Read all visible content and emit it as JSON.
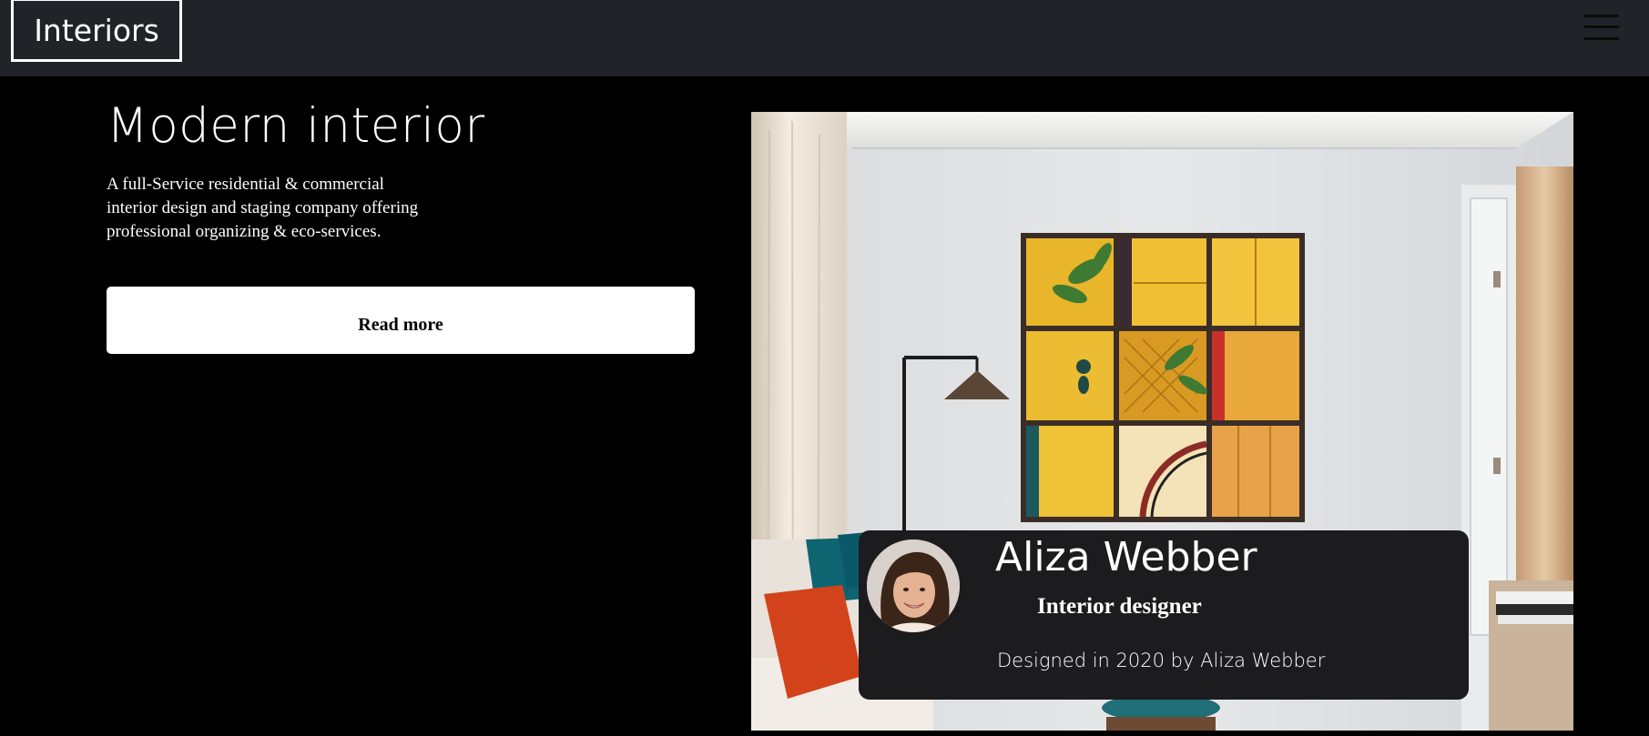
{
  "navbar": {
    "brand": "Interiors",
    "menu_icon": "hamburger-menu-icon"
  },
  "hero": {
    "title": "Modern interior",
    "description": "A full-Service residential & commercial interior design and staging company offering professional organizing & eco-services.",
    "button_label": "Read more"
  },
  "media": {
    "room_image": "modern-living-room-photo"
  },
  "profile_card": {
    "name": "Aliza Webber",
    "role": "Interior designer",
    "credit": "Designed in 2020 by Aliza Webber",
    "avatar": "avatar-photo"
  },
  "colors": {
    "page_background": "#000000",
    "navbar_background": "#212328",
    "card_background": "#1c1c1e",
    "button_background": "#ffffff",
    "text": "#ffffff"
  }
}
